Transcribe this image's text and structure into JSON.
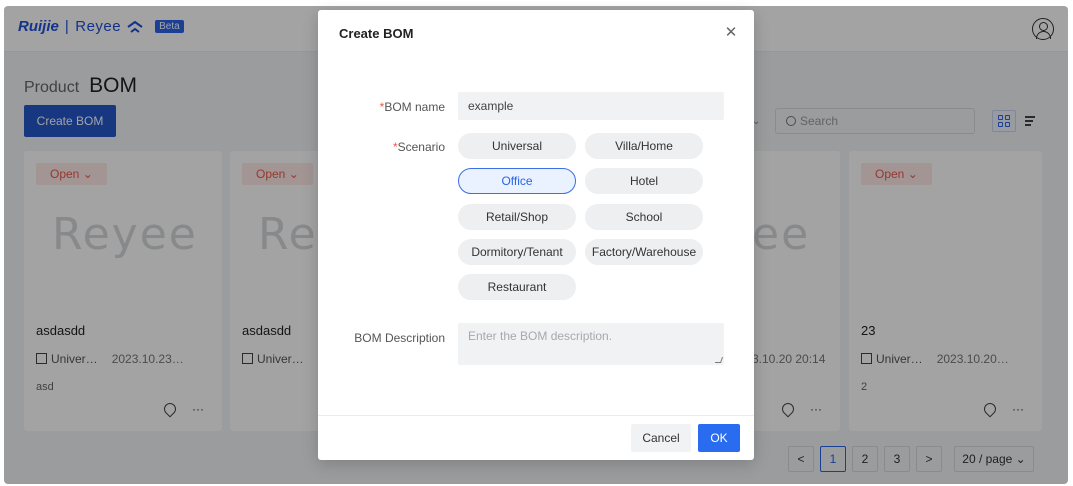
{
  "header": {
    "brand_primary": "Ruijie",
    "brand_separator": "|",
    "brand_secondary": "Reyee",
    "beta_badge": "Beta",
    "user_icon": "user-circle-icon"
  },
  "page": {
    "title_prefix": "Product",
    "title": "BOM",
    "create_button": "Create BOM",
    "search_placeholder": "Search",
    "filter_icon": "chevron-down-icon",
    "view_grid_icon": "grid-view-icon",
    "view_list_icon": "list-view-icon"
  },
  "cards": [
    {
      "status": "Open",
      "logo": "Reyee",
      "name": "asdasdd",
      "scenario": "Univer…",
      "date": "2023.10.23…",
      "description": "asd"
    },
    {
      "status": "Open",
      "logo": "Re",
      "name": "asdasdd",
      "scenario": "Univer…",
      "date": "",
      "description": ""
    },
    {
      "status": "",
      "logo": "ee",
      "name": "",
      "scenario": "",
      "date": "3.10.20 20:14",
      "description": ""
    },
    {
      "status": "Open",
      "logo": "",
      "name": "23",
      "scenario": "Univer…",
      "date": "2023.10.20…",
      "description": "2"
    }
  ],
  "pagination": {
    "prev": "<",
    "pages": [
      "1",
      "2",
      "3"
    ],
    "current": "1",
    "next": ">",
    "page_size": "20 / page"
  },
  "modal": {
    "title": "Create BOM",
    "close_icon": "close-icon",
    "required_mark": "*",
    "name_label": "BOM name",
    "name_value": "example",
    "scenario_label": "Scenario",
    "scenarios": [
      "Universal",
      "Villa/Home",
      "Office",
      "Hotel",
      "Retail/Shop",
      "School",
      "Dormitory/Tenant",
      "Factory/Warehouse",
      "Restaurant"
    ],
    "selected_scenario": "Office",
    "description_label": "BOM Description",
    "description_placeholder": "Enter the BOM description.",
    "cancel_button": "Cancel",
    "ok_button": "OK"
  },
  "colors": {
    "accent": "#2a63e8",
    "open_badge_text": "#e8594d",
    "open_badge_bg": "#fde9e7",
    "ok_button": "#2a6cf0"
  }
}
